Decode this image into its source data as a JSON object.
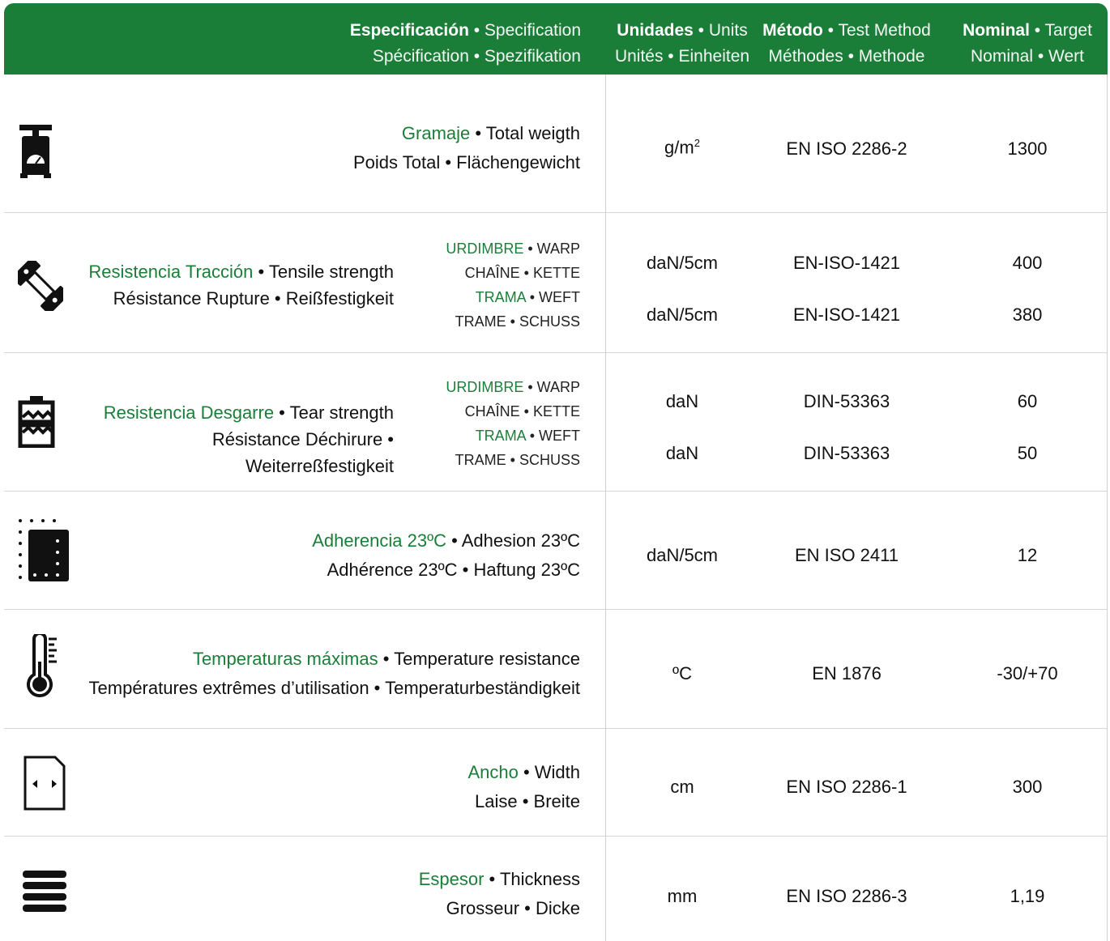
{
  "header": {
    "spec_bold": "Especificación",
    "spec_rest": " • Specification",
    "spec_line2": "Spécification • Spezifikation",
    "units_bold": "Unidades",
    "units_rest": " • Units",
    "units_line2": "Unités • Einheiten",
    "method_bold": "Método",
    "method_rest": " • Test Method",
    "method_line2": "Méthodes • Methode",
    "nominal_bold": "Nominal",
    "nominal_rest": " • Target",
    "nominal_line2": "Nominal • Wert"
  },
  "directions": {
    "warp_green": "URDIMBRE",
    "warp_rest": " • WARP",
    "warp_line2": "CHAÎNE • KETTE",
    "weft_green": "TRAMA",
    "weft_rest": " • WEFT",
    "weft_line2": "TRAME • SCHUSS"
  },
  "rows": [
    {
      "icon": "scale-icon",
      "name_green": "Gramaje",
      "name_rest": " • Total weigth",
      "line2": "Poids Total • Flächengewicht",
      "unit_base": "g/m",
      "unit_sup": "2",
      "method": "EN ISO 2286-2",
      "nominal": "1300"
    },
    {
      "icon": "tensile-icon",
      "name_green": "Resistencia Tracción",
      "name_rest": " • Tensile strength",
      "line2": "Résistance Rupture • Reißfestigkeit",
      "unit_warp": "daN/5cm",
      "unit_weft": "daN/5cm",
      "method_warp": "EN-ISO-1421",
      "method_weft": "EN-ISO-1421",
      "nominal_warp": "400",
      "nominal_weft": "380"
    },
    {
      "icon": "tear-icon",
      "name_green": "Resistencia Desgarre",
      "name_rest": " • Tear strength",
      "line2": "Résistance Déchirure  • Weiterreßfestigkeit",
      "unit_warp": "daN",
      "unit_weft": "daN",
      "method_warp": "DIN-53363",
      "method_weft": "DIN-53363",
      "nominal_warp": "60",
      "nominal_weft": "50"
    },
    {
      "icon": "adhesion-icon",
      "name_green": "Adherencia 23ºC",
      "name_rest": " • Adhesion 23ºC",
      "line2": "Adhérence 23ºC • Haftung 23ºC",
      "unit": "daN/5cm",
      "method": "EN ISO 2411",
      "nominal": "12"
    },
    {
      "icon": "thermometer-icon",
      "name_green": "Temperaturas máximas",
      "name_rest": " • Temperature resistance",
      "line2": "Températures extrêmes d’utilisation • Temperaturbeständigkeit",
      "unit": "ºC",
      "method": "EN 1876",
      "nominal": "-30/+70"
    },
    {
      "icon": "width-icon",
      "name_green": "Ancho",
      "name_rest": " • Width",
      "line2": "Laise • Breite",
      "unit": "cm",
      "method": "EN ISO 2286-1",
      "nominal": "300"
    },
    {
      "icon": "thickness-icon",
      "name_green": "Espesor",
      "name_rest": " • Thickness",
      "line2": "Grosseur • Dicke",
      "unit": "mm",
      "method": "EN ISO 2286-3",
      "nominal": "1,19"
    }
  ]
}
